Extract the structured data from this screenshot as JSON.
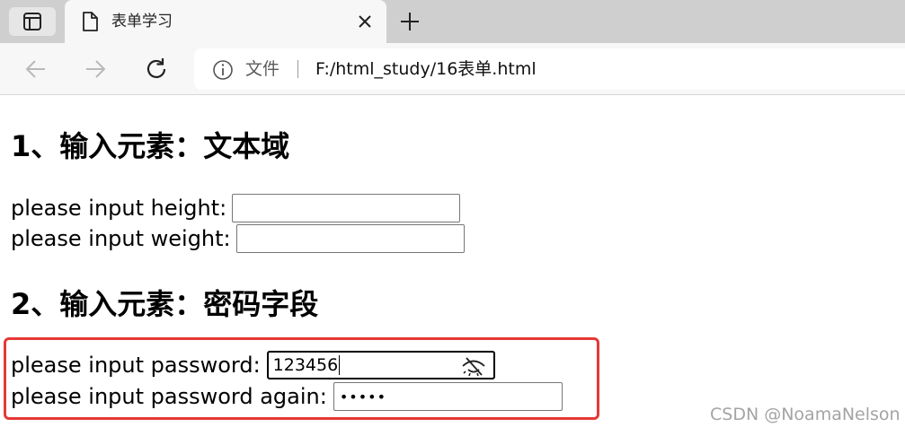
{
  "browser": {
    "tab_title": "表单学习",
    "address": {
      "scheme_label": "文件",
      "url": "F:/html_study/16表单.html"
    }
  },
  "page": {
    "section1": {
      "heading": "1、输入元素：文本域",
      "height_label": "please input height:",
      "height_value": "",
      "weight_label": "please input weight:",
      "weight_value": ""
    },
    "section2": {
      "heading": "2、输入元素：密码字段",
      "password_label": "please input password:",
      "password_value": "123456",
      "password_again_label": "please input password again:",
      "password_again_masked": "•••••"
    }
  },
  "watermark": "CSDN @NoamaNelson",
  "colors": {
    "highlight": "#e53935",
    "tabstrip": "#cfcfcf",
    "toolbar": "#f7f7f7"
  },
  "icons": {
    "tab_actions": "tab-actions-icon",
    "page": "page-icon",
    "close": "close-icon",
    "new_tab": "plus-icon",
    "back": "back-arrow-icon",
    "forward": "forward-arrow-icon",
    "reload": "reload-icon",
    "info": "info-icon",
    "reveal_password": "eye-slash-icon"
  }
}
